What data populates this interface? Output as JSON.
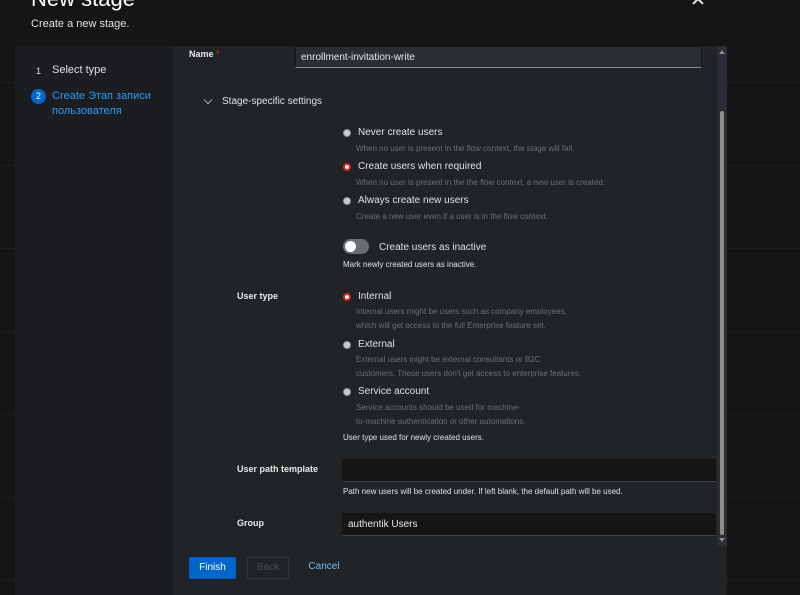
{
  "modal": {
    "title": "New stage",
    "description": "Create a new stage."
  },
  "nav": {
    "steps": [
      {
        "number": "1",
        "label": "Select type"
      },
      {
        "number": "2",
        "label": "Create Этап записи пользователя"
      }
    ]
  },
  "form": {
    "name_label": "Name",
    "name_required": "*",
    "name_value": "enrollment-invitation-write",
    "section_title": "Stage-specific settings",
    "create_mode": {
      "options": [
        {
          "label": "Never create users",
          "help": "When no user is present in the flow context, the stage will fail.",
          "checked": false
        },
        {
          "label": "Create users when required",
          "help": "When no user is present in the the flow context, a new user is created.",
          "checked": true
        },
        {
          "label": "Always create new users",
          "help": "Create a new user even if a user is in the flow context.",
          "checked": false
        }
      ]
    },
    "inactive_switch": {
      "label": "Create users as inactive",
      "help": "Mark newly created users as inactive."
    },
    "user_type": {
      "label": "User type",
      "options": [
        {
          "label": "Internal",
          "help1": "Internal users might be users such as company employees,",
          "help2": "which will get access to the full Enterprise feature set.",
          "checked": true
        },
        {
          "label": "External",
          "help1": "External users might be external consultants or B2C",
          "help2": "customers. These users don't get access to enterprise features.",
          "checked": false
        },
        {
          "label": "Service account",
          "help1": "Service accounts should be used for machine-",
          "help2": "to-machine authentication or other automations.",
          "checked": false
        }
      ],
      "help": "User type used for newly created users."
    },
    "user_path": {
      "label": "User path template",
      "value": "",
      "help": "Path new users will be created under. If left blank, the default path will be used."
    },
    "group": {
      "label": "Group",
      "value": "authentik Users"
    }
  },
  "footer": {
    "finish": "Finish",
    "back": "Back",
    "cancel": "Cancel"
  },
  "colors": {
    "primary": "#0066cc",
    "link": "#73bcf7",
    "radio_checked": "#e02020"
  }
}
